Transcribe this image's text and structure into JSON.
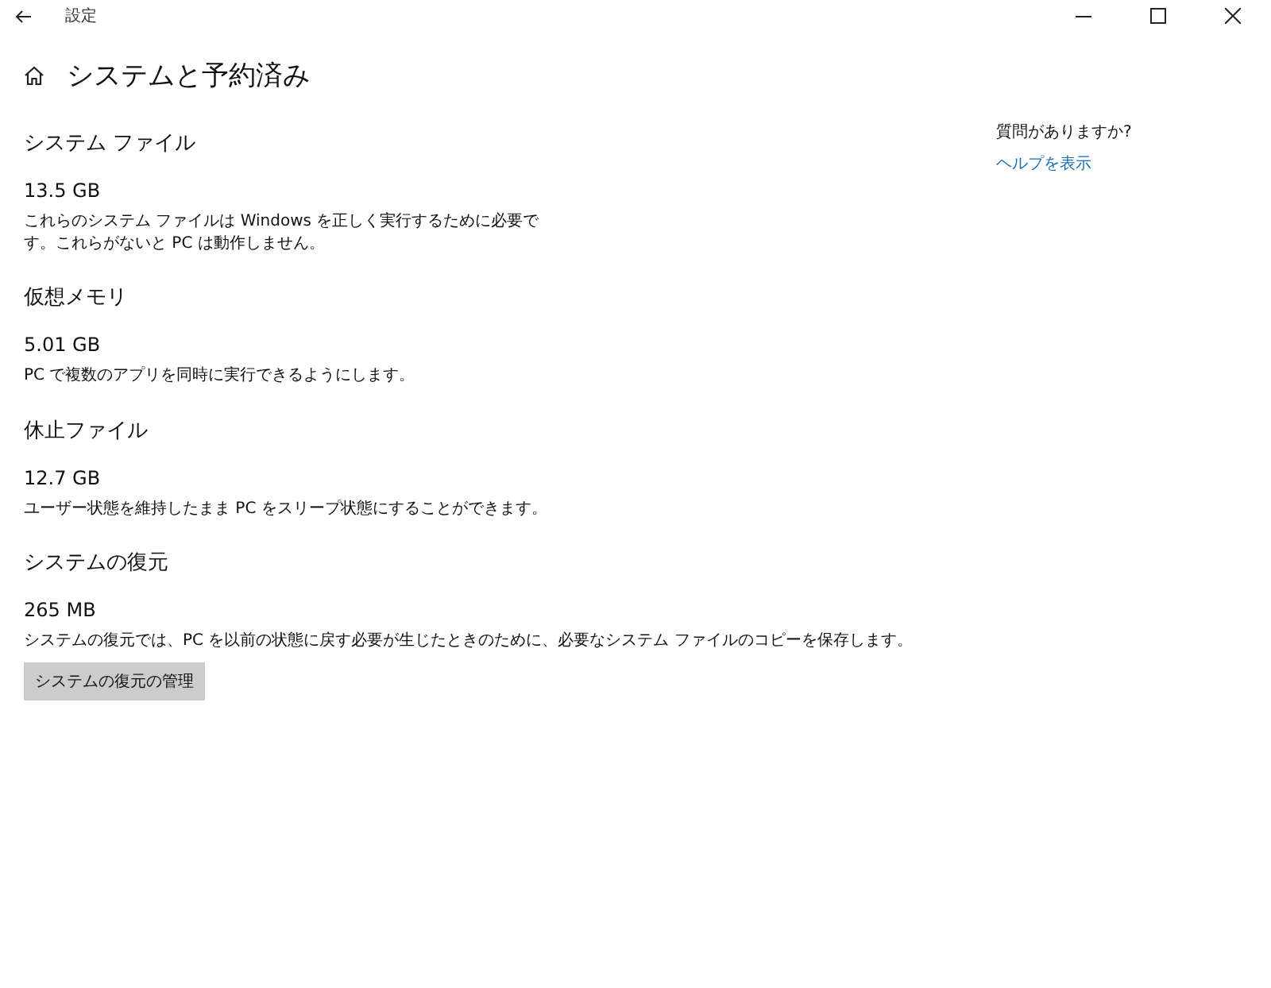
{
  "window": {
    "title": "設定"
  },
  "page": {
    "title": "システムと予約済み"
  },
  "sections": [
    {
      "heading": "システム ファイル",
      "size": "13.5 GB",
      "description": "これらのシステム ファイルは Windows を正しく実行するために必要です。これらがないと PC は動作しません。"
    },
    {
      "heading": "仮想メモリ",
      "size": "5.01 GB",
      "description": "PC で複数のアプリを同時に実行できるようにします。"
    },
    {
      "heading": "休止ファイル",
      "size": "12.7 GB",
      "description": "ユーザー状態を維持したまま PC をスリープ状態にすることができます。"
    },
    {
      "heading": "システムの復元",
      "size": "265 MB",
      "description": "システムの復元では、PC を以前の状態に戻す必要が生じたときのために、必要なシステム ファイルのコピーを保存します。",
      "button": "システムの復元の管理"
    }
  ],
  "help": {
    "question": "質問がありますか?",
    "link": "ヘルプを表示"
  }
}
